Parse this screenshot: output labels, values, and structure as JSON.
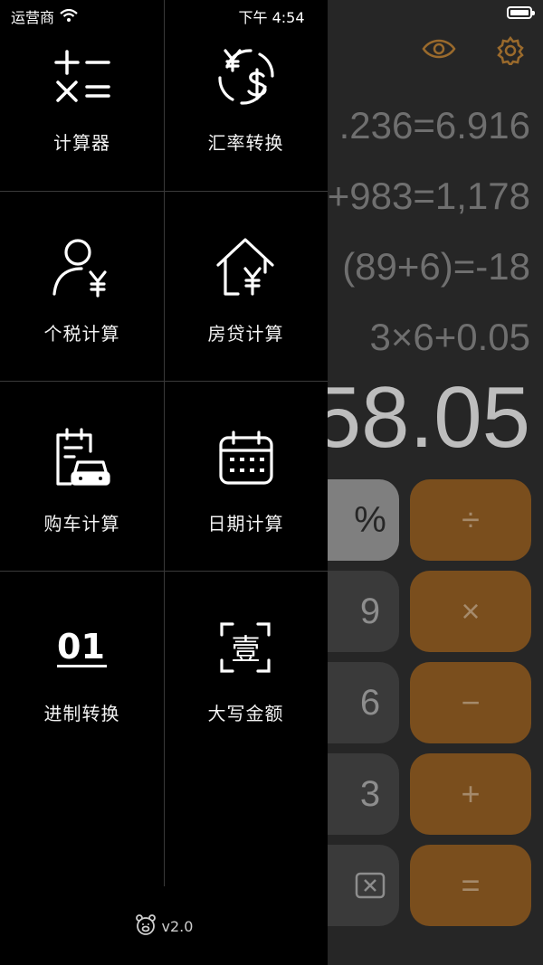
{
  "status_bar": {
    "carrier": "运营商",
    "time": "下午 4:54"
  },
  "drawer": {
    "items": [
      {
        "label": "计算器",
        "icon": "calculator-ops-icon"
      },
      {
        "label": "汇率转换",
        "icon": "currency-exchange-icon"
      },
      {
        "label": "个税计算",
        "icon": "person-tax-icon"
      },
      {
        "label": "房贷计算",
        "icon": "house-loan-icon"
      },
      {
        "label": "购车计算",
        "icon": "car-loan-icon"
      },
      {
        "label": "日期计算",
        "icon": "calendar-icon"
      },
      {
        "label": "进制转换",
        "icon": "binary-icon",
        "icon_text": "01"
      },
      {
        "label": "大写金额",
        "icon": "chinese-numeral-icon",
        "icon_text": "壹"
      }
    ],
    "version": "v2.0"
  },
  "calculator": {
    "history": [
      ".236=6.916",
      "+983=1,178",
      "(89+6)=-18",
      "3×6+0.05"
    ],
    "result": "58.05",
    "keys": {
      "percent": "%",
      "divide": "÷",
      "nine": "9",
      "multiply": "×",
      "six": "6",
      "minus": "−",
      "three": "3",
      "plus": "+",
      "equals": "="
    }
  }
}
